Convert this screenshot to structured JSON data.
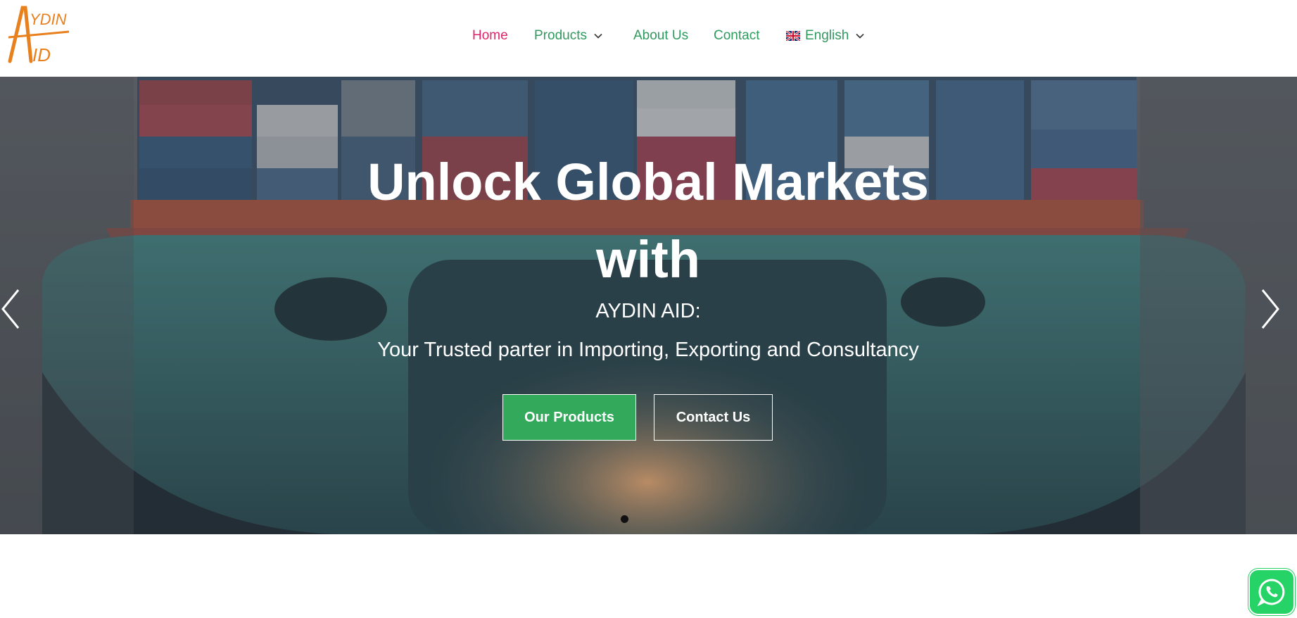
{
  "brand": {
    "logo_top": "YDIN",
    "logo_letters": "AID",
    "logo_color": "#e8801e"
  },
  "nav": {
    "home": "Home",
    "products": "Products",
    "about": "About Us",
    "contact": "Contact",
    "language": "English",
    "active_color": "#e0226b",
    "link_color": "#2e9a5e"
  },
  "hero": {
    "title_line1": "Unlock Global Markets",
    "title_line2": "with",
    "subtitle1": "AYDIN AID:",
    "subtitle2": "Your Trusted parter in Importing, Exporting and Consultancy",
    "primary_button": "Our Products",
    "secondary_button": "Contact Us",
    "button_color": "#33a95c"
  },
  "icons": {
    "prev": "chevron-left-icon",
    "next": "chevron-right-icon",
    "whatsapp": "whatsapp-icon",
    "flag": "uk-flag-icon"
  }
}
